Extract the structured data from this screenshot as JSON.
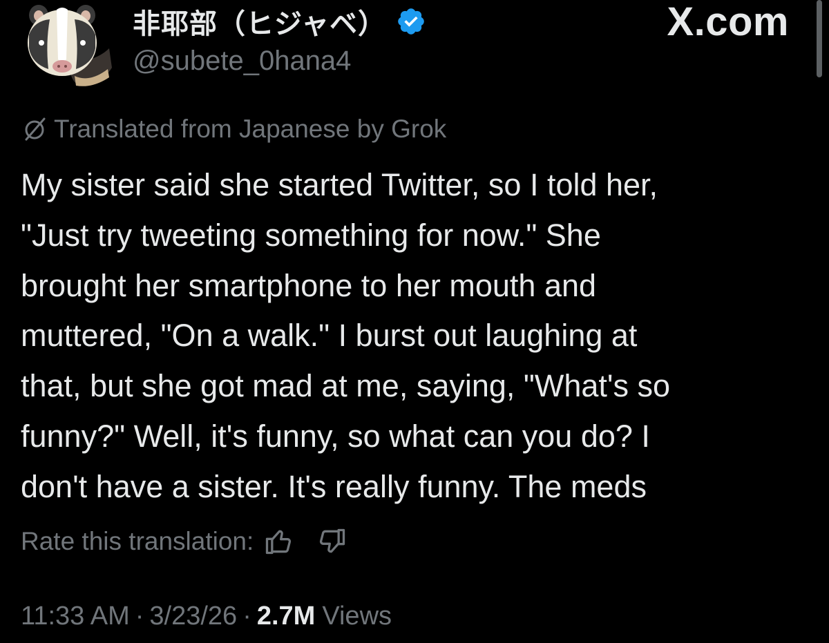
{
  "author": {
    "display_name": "非耶部（ヒジャベ）",
    "handle": "@subete_0hana4",
    "verified": true,
    "avatar_icon": "skunk-face-icon"
  },
  "brand": {
    "label": "X.com"
  },
  "translation": {
    "notice": "Translated from Japanese by Grok",
    "icon": "grok-icon"
  },
  "tweet": {
    "lines": [
      "My sister said she started Twitter, so I told her,",
      "\"Just try tweeting something for now.\" She",
      "brought her smartphone to her mouth and",
      "muttered, \"On a walk.\" I burst out laughing at",
      "that, but she got mad at me, saying, \"What's so",
      "funny?\" Well, it's funny, so what can you do? I",
      "don't have a sister. It's really funny. The meds"
    ]
  },
  "rate": {
    "label": "Rate this translation:",
    "thumbs_up_icon": "thumbs-up-icon",
    "thumbs_down_icon": "thumbs-down-icon"
  },
  "meta": {
    "time": "11:33 AM",
    "separator": "·",
    "date": "3/23/26",
    "views_count": "2.7M",
    "views_label": "Views"
  },
  "colors": {
    "background": "#000000",
    "text_primary": "#e7e9ea",
    "text_secondary": "#71767b",
    "verified_blue": "#1d9bf0"
  }
}
